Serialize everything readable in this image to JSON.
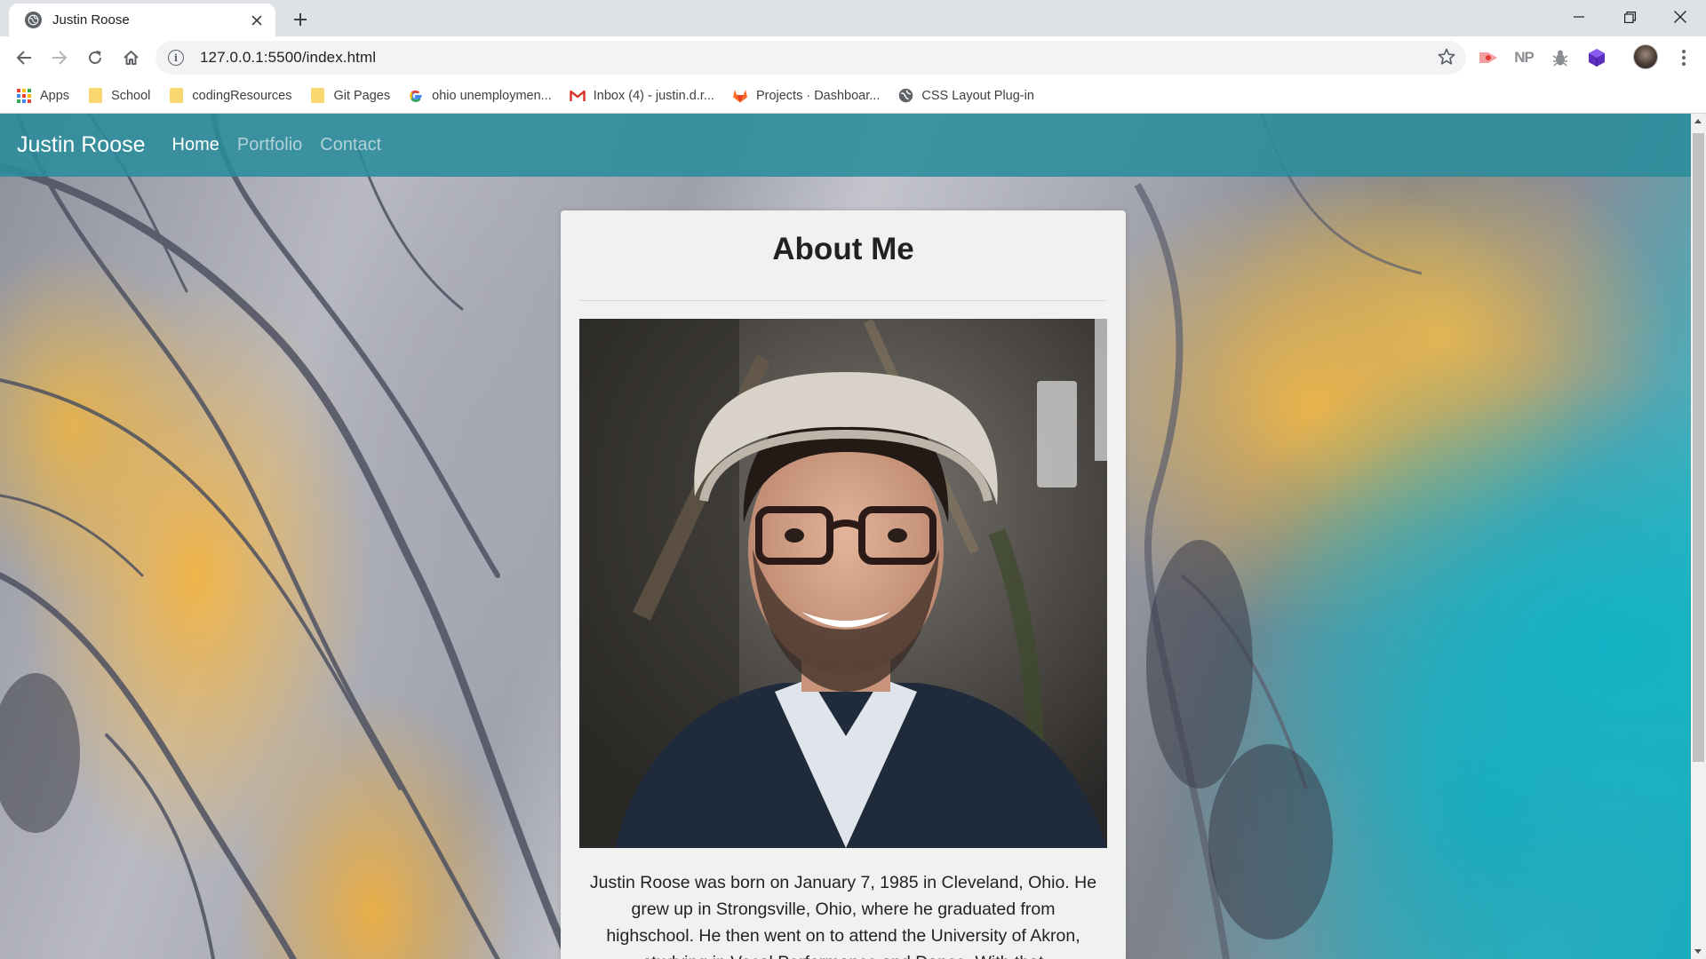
{
  "browser": {
    "tab": {
      "title": "Justin Roose"
    },
    "address_bar": {
      "url": "127.0.0.1:5500/index.html"
    },
    "bookmarks": [
      {
        "label": "Apps",
        "icon": "apps-grid-icon"
      },
      {
        "label": "School",
        "icon": "folder-icon"
      },
      {
        "label": "codingResources",
        "icon": "folder-icon"
      },
      {
        "label": "Git Pages",
        "icon": "folder-icon"
      },
      {
        "label": "ohio unemploymen...",
        "icon": "google-icon"
      },
      {
        "label": "Inbox (4) - justin.d.r...",
        "icon": "gmail-icon"
      },
      {
        "label": "Projects · Dashboar...",
        "icon": "gitlab-icon"
      },
      {
        "label": "CSS Layout Plug-in",
        "icon": "globe-icon"
      }
    ],
    "extensions": {
      "np_label": "NP"
    }
  },
  "site": {
    "brand": "Justin Roose",
    "nav": [
      {
        "label": "Home",
        "active": true
      },
      {
        "label": "Portfolio",
        "active": false
      },
      {
        "label": "Contact",
        "active": false
      }
    ],
    "about": {
      "title": "About Me",
      "photo": "portrait-photo",
      "bio": "Justin Roose was born on January 7, 1985 in Cleveland, Ohio. He grew up in Strongsville, Ohio, where he graduated from highschool. He then went on to attend the University of Akron, studying in Vocal Performance and Dance. With that"
    }
  },
  "colors": {
    "navbar": "#2a8c9b",
    "card_background": "#f1f1f1",
    "tabstrip": "#dee1e6"
  }
}
